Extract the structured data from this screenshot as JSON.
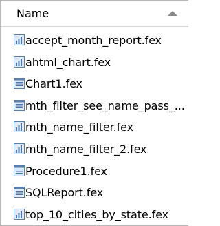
{
  "column_header": {
    "label": "Name",
    "sort_direction": "ascending",
    "sort_icon": "chevron-up-icon"
  },
  "files": [
    {
      "name": "accept_month_report.fex",
      "icon": "report-chart-icon"
    },
    {
      "name": "ahtml_chart.fex",
      "icon": "report-chart-icon"
    },
    {
      "name": "Chart1.fex",
      "icon": "procedure-doc-icon"
    },
    {
      "name": "mth_filter_see_name_pass_...",
      "icon": "procedure-doc-icon"
    },
    {
      "name": "mth_name_filter.fex",
      "icon": "report-chart-icon"
    },
    {
      "name": "mth_name_filter_2.fex",
      "icon": "report-chart-icon"
    },
    {
      "name": "Procedure1.fex",
      "icon": "procedure-doc-icon"
    },
    {
      "name": "SQLReport.fex",
      "icon": "procedure-doc-icon"
    },
    {
      "name": "top_10_cities_by_state.fex",
      "icon": "report-chart-icon"
    }
  ],
  "colors": {
    "icon_border": "#5a7fa8",
    "icon_fill": "#dfe9f5",
    "icon_bars": "#4a78b0",
    "sort_arrow": "#8a8a8a",
    "header_divider": "#d6d6d6"
  }
}
